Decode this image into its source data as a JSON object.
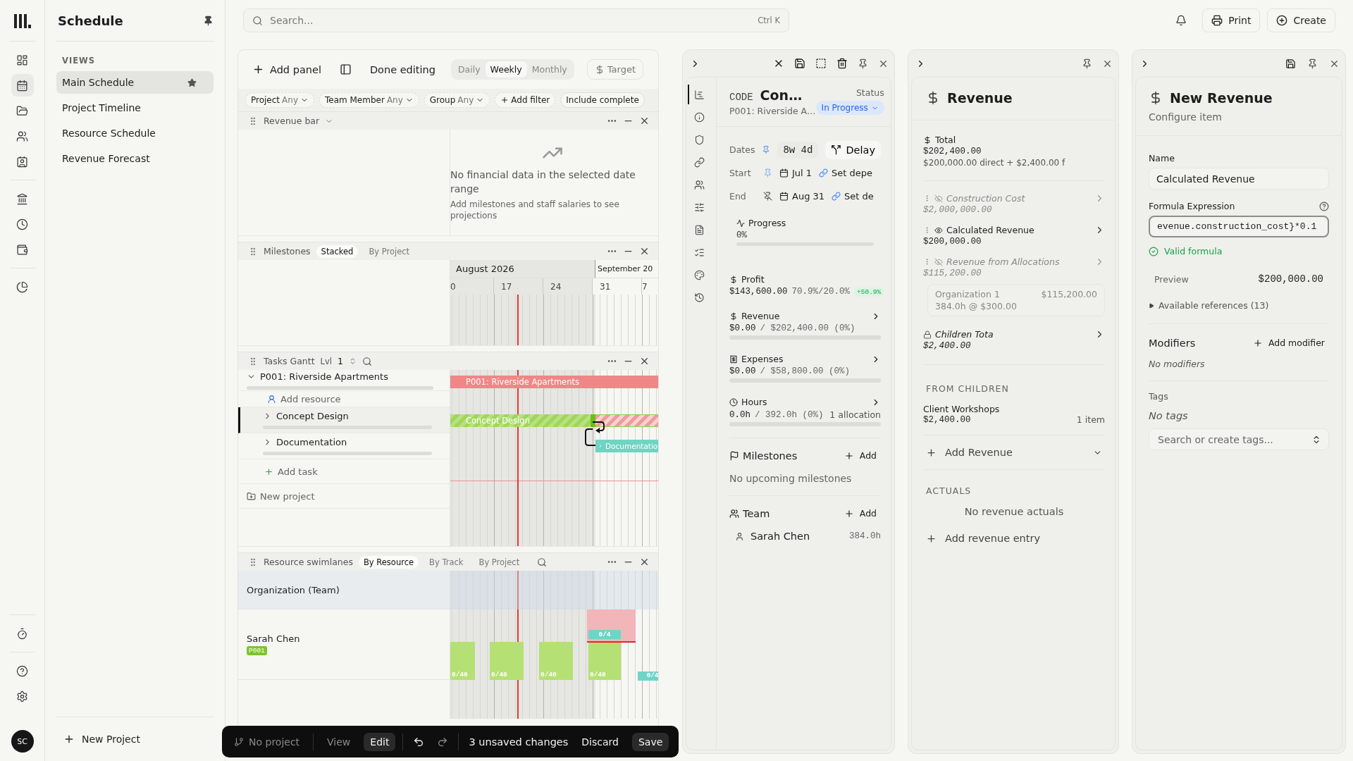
{
  "rail": {
    "top": [
      {
        "kind": "dashboard",
        "selected": false
      },
      {
        "kind": "calendar",
        "selected": true
      },
      {
        "kind": "folder",
        "selected": false
      },
      {
        "kind": "users",
        "selected": false
      },
      {
        "kind": "contact",
        "selected": false
      }
    ],
    "middle": [
      {
        "kind": "bank",
        "selected": false
      },
      {
        "kind": "clock",
        "selected": false
      },
      {
        "kind": "wallet",
        "selected": false
      }
    ],
    "reports": [
      {
        "kind": "pie",
        "selected": false
      }
    ],
    "bottom": [
      {
        "kind": "timer",
        "selected": false
      }
    ],
    "footer": [
      {
        "kind": "help",
        "selected": false
      },
      {
        "kind": "settings",
        "selected": false
      }
    ],
    "avatar": "SC"
  },
  "sidebar": {
    "title": "Schedule",
    "section": "VIEWS",
    "views": [
      {
        "label": "Main Schedule",
        "selected": true,
        "starred": true
      },
      {
        "label": "Project Timeline",
        "selected": false,
        "starred": false
      },
      {
        "label": "Resource Schedule",
        "selected": false,
        "starred": false
      },
      {
        "label": "Revenue Forecast",
        "selected": false,
        "starred": false
      }
    ],
    "new_project": "New Project"
  },
  "topbar": {
    "search": {
      "placeholder": "Search...",
      "shortcut": "Ctrl K"
    },
    "print": "Print",
    "create": "Create"
  },
  "board": {
    "toolbar": {
      "add_panel": "Add panel",
      "done_editing": "Done editing",
      "scales": [
        {
          "label": "Daily",
          "selected": false
        },
        {
          "label": "Weekly",
          "selected": true
        },
        {
          "label": "Monthly",
          "selected": false
        }
      ],
      "target": "Target"
    },
    "filters": [
      {
        "kind": "select",
        "label": "Project",
        "value": "Any"
      },
      {
        "kind": "select",
        "label": "Team Member",
        "value": "Any"
      },
      {
        "kind": "select",
        "label": "Group",
        "value": "Any"
      },
      {
        "kind": "add",
        "label": "Add filter"
      },
      {
        "kind": "toggle",
        "label": "Include complete"
      }
    ],
    "revenue_panel": {
      "title": "Revenue bar",
      "empty_title": "No financial data in the selected date range",
      "empty_hint": "Add milestones and staff salaries to see projections"
    },
    "timeline": {
      "months": [
        "August 2026",
        "September 20"
      ],
      "weeks": [
        "0",
        "17",
        "24",
        "31",
        "7"
      ]
    },
    "milestones_panel": {
      "title": "Milestones",
      "modes": [
        {
          "label": "Stacked",
          "selected": true
        },
        {
          "label": "By Project",
          "selected": false
        }
      ]
    },
    "tasks_panel": {
      "title": "Tasks Gantt",
      "level_label": "Lvl",
      "level": "1",
      "rows": [
        {
          "kind": "project",
          "label": "P001: Riverside Apartments",
          "expanded": true,
          "selected": false,
          "bar": "P001: Riverside Apartments",
          "color": "#f08686",
          "hatched": false,
          "overrun": false
        },
        {
          "kind": "add_resource",
          "label": "Add resource"
        },
        {
          "kind": "task",
          "label": "Concept Design",
          "expanded": false,
          "selected": true,
          "bar": "Concept Design",
          "color": "#9fd65a",
          "hatched": true,
          "overrun": true
        },
        {
          "kind": "task",
          "label": "Documentation",
          "expanded": false,
          "selected": false,
          "bar": "Documentatio",
          "color": "#6fd4c2",
          "hatched": false,
          "overrun": false
        },
        {
          "kind": "add_task",
          "label": "Add task"
        },
        {
          "kind": "new_project",
          "label": "New project"
        }
      ]
    },
    "resource_panel": {
      "title": "Resource swimlanes",
      "modes": [
        {
          "label": "By Resource",
          "selected": true
        },
        {
          "label": "By Track",
          "selected": false
        },
        {
          "label": "By Project",
          "selected": false
        }
      ],
      "lanes": [
        {
          "kind": "group",
          "label": "Organization (Team)"
        },
        {
          "kind": "person",
          "label": "Sarah Chen",
          "tag": "P001",
          "blocks": [
            "0/40",
            "0/40",
            "0/40",
            "0/40",
            "0/4"
          ],
          "overload": "0/4"
        }
      ]
    },
    "edit_bar": {
      "project": "No project",
      "modes": [
        {
          "label": "View",
          "selected": false
        },
        {
          "label": "Edit",
          "selected": true
        }
      ],
      "changes": "3 unsaved changes",
      "discard": "Discard",
      "save": "Save"
    }
  },
  "detail": {
    "code_label": "CODE",
    "code": "Con…",
    "subtitle": "P001: Riverside A…",
    "status_label": "Status",
    "status": "In Progress",
    "rail": [
      {
        "kind": "schedule",
        "selected": true
      },
      {
        "kind": "info",
        "selected": false
      },
      {
        "kind": "shield",
        "selected": false
      },
      {
        "kind": "link",
        "selected": false
      },
      {
        "kind": "users",
        "selected": false
      },
      {
        "kind": "sliders",
        "selected": false
      },
      {
        "kind": "file",
        "selected": false
      },
      {
        "kind": "checklist",
        "selected": false
      },
      {
        "kind": "palette",
        "selected": false
      },
      {
        "kind": "history",
        "selected": false
      }
    ],
    "dates": {
      "label": "Dates",
      "duration": "8w 4d",
      "delay": "Delay",
      "start_label": "Start",
      "start": "Jul 1",
      "start_dep": "Set depe",
      "start_pinned": true,
      "end_label": "End",
      "end": "Aug 31",
      "end_dep": "Set de",
      "end_pinned": false
    },
    "progress": {
      "label": "Progress",
      "value": "0%",
      "level": 0
    },
    "profit": {
      "label": "Profit",
      "value": "$143,600.00",
      "ratio": "70.9%/20.0%",
      "delta": "+50.9%"
    },
    "metrics": [
      {
        "kind": "revenue",
        "label": "Revenue",
        "value": "$0.00",
        "total": "/ $202,400.00 (0%)",
        "level": 0
      },
      {
        "kind": "expenses",
        "label": "Expenses",
        "value": "$0.00",
        "total": "/ $58,800.00 (0%)",
        "level": 0
      },
      {
        "kind": "hours",
        "label": "Hours",
        "value": "0.0h",
        "total": "/ 392.0h (0%)",
        "note": "1 allocation",
        "level": 0
      }
    ],
    "milestones": {
      "title": "Milestones",
      "add": "Add",
      "empty": "No upcoming milestones"
    },
    "team": {
      "title": "Team",
      "add": "Add",
      "members": [
        {
          "name": "Sarah Chen",
          "hours": "384.0h"
        }
      ]
    }
  },
  "revenue": {
    "title": "Revenue",
    "total_label": "Total",
    "total": "$202,400.00",
    "breakdown": "$200,000.00 direct + $2,400.00 f",
    "items": [
      {
        "kind": "hidden",
        "name": "Construction Cost",
        "value": "$2,000,000.00"
      },
      {
        "kind": "visible",
        "name": "Calculated Revenue",
        "value": "$200,000.00"
      },
      {
        "kind": "hidden",
        "name": "Revenue from Allocations",
        "value": "$115,200.00",
        "details": [
          {
            "name": "Organization 1",
            "amount": "$115,200.00",
            "rate": "384.0h @ $300.00"
          }
        ]
      },
      {
        "kind": "locked",
        "name": "Children Tota",
        "value": "$2,400.00"
      }
    ],
    "children_heading": "FROM CHILDREN",
    "children": [
      {
        "name": "Client Workshops",
        "value": "$2,400.00",
        "count": "1 item"
      }
    ],
    "add_revenue": "Add Revenue",
    "actuals_heading": "ACTUALS",
    "actuals_empty": "No revenue actuals",
    "add_entry": "Add revenue entry"
  },
  "editor": {
    "title": "New Revenue",
    "subtitle": "Configure item",
    "name_label": "Name",
    "name": "Calculated Revenue",
    "formula_label": "Formula Expression",
    "formula": "evenue.construction_cost}*0.1",
    "valid": "Valid formula",
    "preview_label": "Preview",
    "preview": "$200,000.00",
    "references": "Available references (13)",
    "modifiers_title": "Modifiers",
    "add_modifier": "Add modifier",
    "modifiers_empty": "No modifiers",
    "tags_label": "Tags",
    "tags_empty": "No tags",
    "tags_placeholder": "Search or create tags..."
  }
}
